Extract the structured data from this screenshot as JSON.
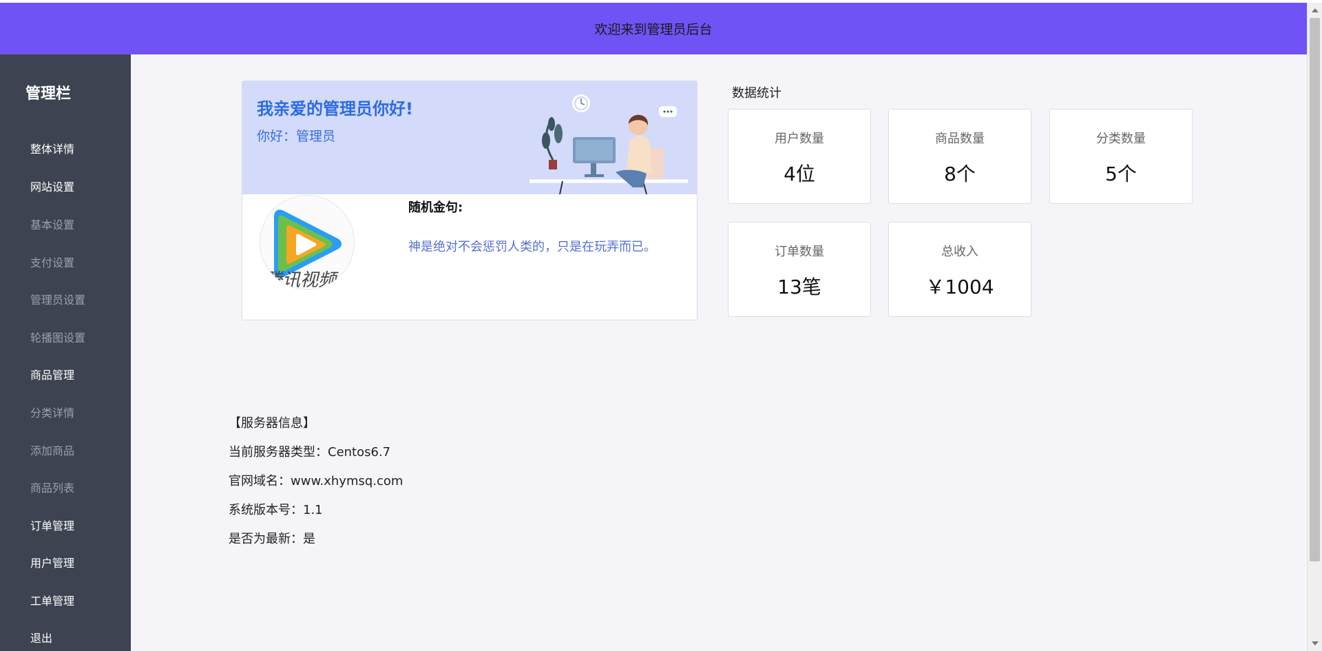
{
  "header": {
    "title": "欢迎来到管理员后台"
  },
  "sidebar": {
    "title": "管理栏",
    "items": [
      {
        "label": "整体详情",
        "kind": "primary"
      },
      {
        "label": "网站设置",
        "kind": "primary"
      },
      {
        "label": "基本设置",
        "kind": "secondary"
      },
      {
        "label": "支付设置",
        "kind": "secondary"
      },
      {
        "label": "管理员设置",
        "kind": "secondary"
      },
      {
        "label": "轮播图设置",
        "kind": "secondary"
      },
      {
        "label": "商品管理",
        "kind": "primary"
      },
      {
        "label": "分类详情",
        "kind": "secondary"
      },
      {
        "label": "添加商品",
        "kind": "secondary"
      },
      {
        "label": "商品列表",
        "kind": "secondary"
      },
      {
        "label": "订单管理",
        "kind": "primary"
      },
      {
        "label": "用户管理",
        "kind": "primary"
      },
      {
        "label": "工单管理",
        "kind": "primary"
      },
      {
        "label": "退出",
        "kind": "primary"
      }
    ]
  },
  "welcome": {
    "title": "我亲爱的管理员你好!",
    "greeting": "你好：管理员",
    "logo_text": "腾讯视频",
    "quote_label": "随机金句:",
    "quote_text": "神是绝对不会惩罚人类的，只是在玩弄而已。"
  },
  "stats": {
    "title": "数据统计",
    "cards": [
      {
        "label": "用户数量",
        "value": "4位"
      },
      {
        "label": "商品数量",
        "value": "8个"
      },
      {
        "label": "分类数量",
        "value": "5个"
      },
      {
        "label": "订单数量",
        "value": "13笔"
      },
      {
        "label": "总收入",
        "value": "￥1004"
      }
    ]
  },
  "server": {
    "heading": "【服务器信息】",
    "type": "当前服务器类型：Centos6.7",
    "domain": "官网域名：www.xhymsq.com",
    "version": "系统版本号：1.1",
    "latest": "是否为最新：是"
  },
  "colors": {
    "header_bg": "#7152f5",
    "sidebar_bg": "#3d4350",
    "main_bg": "#f5f5f9",
    "welcome_bg": "#d4dafa",
    "accent_blue": "#2b6be6"
  }
}
